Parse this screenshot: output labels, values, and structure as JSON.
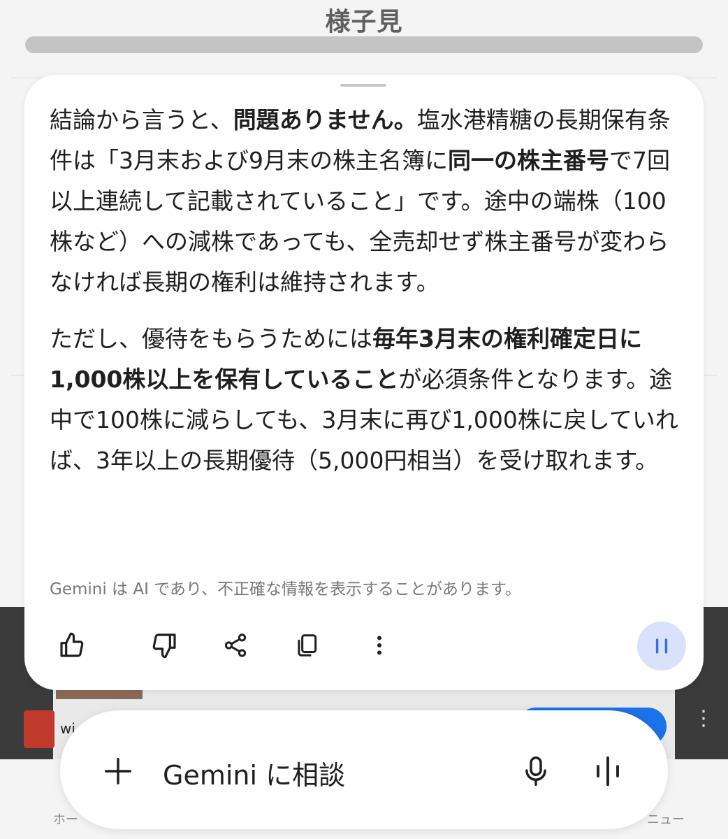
{
  "background": {
    "title": "様子見",
    "small_text": "wi",
    "nav_home": "ホー",
    "nav_menu": "ニュー"
  },
  "response": {
    "p1": [
      {
        "text": "結論から言うと、",
        "bold": false
      },
      {
        "text": "問題ありません。",
        "bold": true
      },
      {
        "text": "塩水港精糖の長期保有条件は「3月末および9月末の株主名簿に",
        "bold": false
      },
      {
        "text": "同一の株主番号",
        "bold": true
      },
      {
        "text": "で7回以上連続して記載されていること」です。途中の端株（100株など）への減株であっても、全売却せず株主番号が変わらなければ長期の権利は維持されます。",
        "bold": false
      }
    ],
    "p2": [
      {
        "text": "ただし、優待をもらうためには",
        "bold": false
      },
      {
        "text": "毎年3月末の権利確定日に1,000株以上を保有していること",
        "bold": true
      },
      {
        "text": "が必須条件となります。途中で100株に減らしても、3月末に再び1,000株に戻していれば、3年以上の長期優待（5,000円相当）を受け取れます。",
        "bold": false
      }
    ],
    "disclaimer": "Gemini は AI であり、不正確な情報を表示することがあります。"
  },
  "actions": {
    "icons": [
      "thumbs-up-icon",
      "thumbs-down-icon",
      "share-icon",
      "copy-icon",
      "more-vert-icon",
      "pause-icon"
    ]
  },
  "input": {
    "placeholder": "Gemini に相談",
    "icons": [
      "plus-icon",
      "mic-icon",
      "live-waveform-icon"
    ]
  },
  "colors": {
    "pause_bg": "#d8e3fb",
    "accent": "#1a73e8",
    "text": "#1f1f1f",
    "muted": "#777777"
  }
}
